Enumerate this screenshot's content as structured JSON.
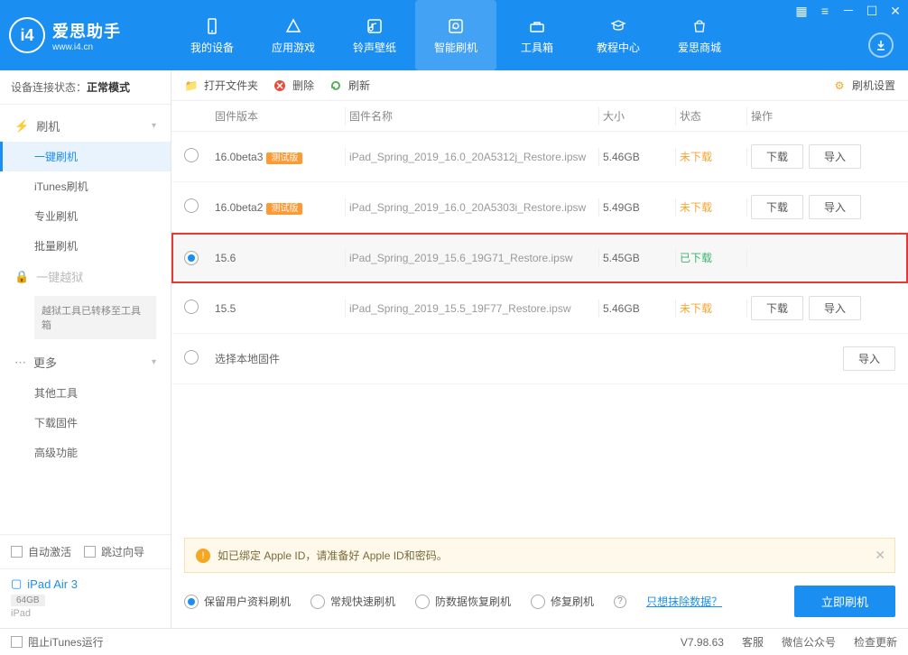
{
  "logo": {
    "glyph": "i4",
    "cn": "爱思助手",
    "en": "www.i4.cn"
  },
  "nav": [
    {
      "label": "我的设备"
    },
    {
      "label": "应用游戏"
    },
    {
      "label": "铃声壁纸"
    },
    {
      "label": "智能刷机",
      "active": true
    },
    {
      "label": "工具箱"
    },
    {
      "label": "教程中心"
    },
    {
      "label": "爱思商城"
    }
  ],
  "device_status": {
    "label": "设备连接状态：",
    "value": "正常模式"
  },
  "sidebar": {
    "group_flash": "刷机",
    "items_flash": [
      "一键刷机",
      "iTunes刷机",
      "专业刷机",
      "批量刷机"
    ],
    "active_flash_index": 0,
    "group_jailbreak": "一键越狱",
    "jailbreak_note": "越狱工具已转移至工具箱",
    "group_more": "更多",
    "items_more": [
      "其他工具",
      "下载固件",
      "高级功能"
    ],
    "auto_activate": "自动激活",
    "skip_guide": "跳过向导"
  },
  "device": {
    "name": "iPad Air 3",
    "capacity": "64GB",
    "type": "iPad"
  },
  "toolbar": {
    "open_folder": "打开文件夹",
    "delete": "删除",
    "refresh": "刷新",
    "flash_settings": "刷机设置"
  },
  "columns": {
    "version": "固件版本",
    "name": "固件名称",
    "size": "大小",
    "status": "状态",
    "ops": "操作"
  },
  "buttons": {
    "download": "下载",
    "import": "导入"
  },
  "rows": [
    {
      "version": "16.0beta3",
      "beta": "测试版",
      "name": "iPad_Spring_2019_16.0_20A5312j_Restore.ipsw",
      "size": "5.46GB",
      "status": "未下载",
      "status_class": "orange",
      "selected": false,
      "ops": true
    },
    {
      "version": "16.0beta2",
      "beta": "测试版",
      "name": "iPad_Spring_2019_16.0_20A5303i_Restore.ipsw",
      "size": "5.49GB",
      "status": "未下载",
      "status_class": "orange",
      "selected": false,
      "ops": true
    },
    {
      "version": "15.6",
      "name": "iPad_Spring_2019_15.6_19G71_Restore.ipsw",
      "size": "5.45GB",
      "status": "已下载",
      "status_class": "green",
      "selected": true,
      "highlight": true,
      "ops": false
    },
    {
      "version": "15.5",
      "name": "iPad_Spring_2019_15.5_19F77_Restore.ipsw",
      "size": "5.46GB",
      "status": "未下载",
      "status_class": "orange",
      "selected": false,
      "ops": true
    },
    {
      "version": "选择本地固件",
      "local": true
    }
  ],
  "alert": "如已绑定 Apple ID，请准备好 Apple ID和密码。",
  "options": {
    "keep_data": "保留用户资料刷机",
    "normal": "常规快速刷机",
    "anti_recovery": "防数据恢复刷机",
    "repair": "修复刷机",
    "erase_link": "只想抹除数据？",
    "flash_now": "立即刷机"
  },
  "footer": {
    "block_itunes": "阻止iTunes运行",
    "version": "V7.98.63",
    "support": "客服",
    "wechat": "微信公众号",
    "check_update": "检查更新"
  }
}
